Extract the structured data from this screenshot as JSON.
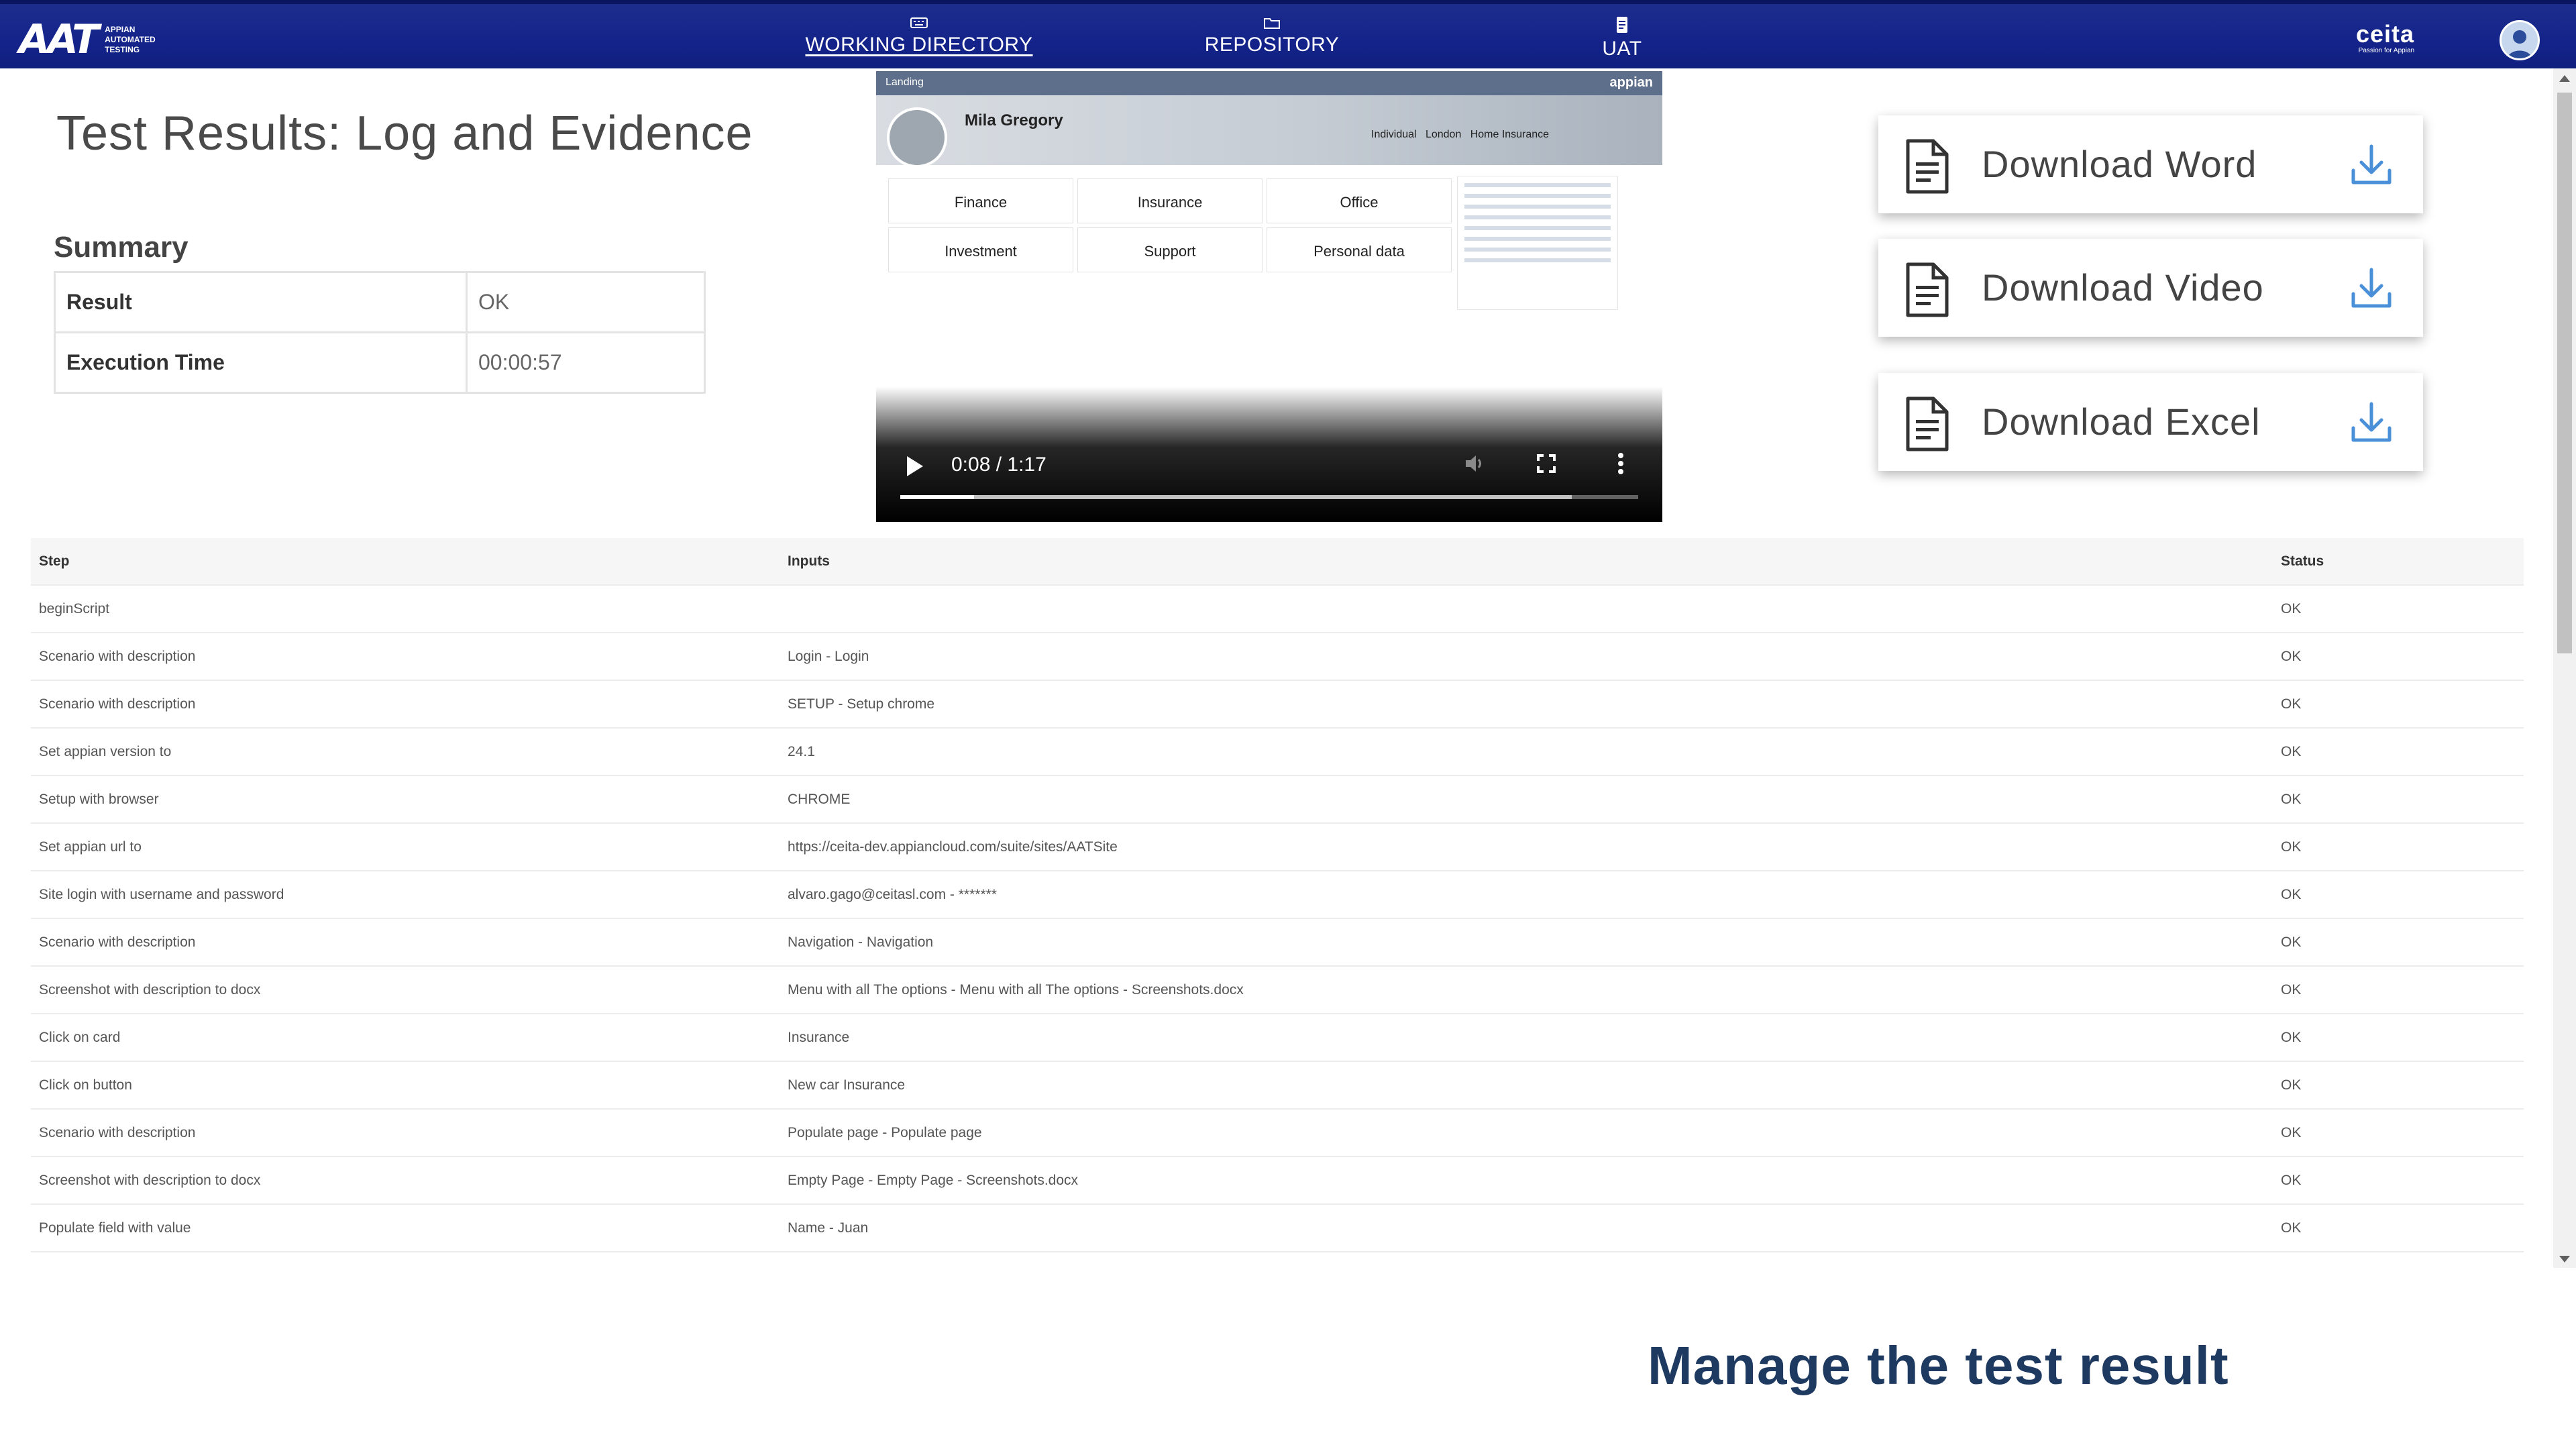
{
  "header": {
    "logo_mark": "AAT",
    "logo_sub": [
      "APPIAN",
      "AUTOMATED",
      "TESTING"
    ],
    "nav": [
      {
        "label": "WORKING DIRECTORY",
        "icon": "keyboard-icon",
        "active": true
      },
      {
        "label": "REPOSITORY",
        "icon": "folder-icon",
        "active": false
      },
      {
        "label": "UAT",
        "icon": "document-icon",
        "active": false
      }
    ],
    "brand": "ceita",
    "brand_tag": "Passion for Appian",
    "avatar_icon": "user-avatar-icon"
  },
  "page": {
    "title": "Test Results: Log and Evidence",
    "summary_title": "Summary",
    "summary": [
      {
        "key": "Result",
        "value": "OK"
      },
      {
        "key": "Execution Time",
        "value": "00:00:57"
      }
    ]
  },
  "video": {
    "frame": {
      "breadcrumb": "Landing",
      "app": "appian",
      "user_name": "Mila Gregory",
      "segment": "Individual",
      "office": "London",
      "contract": "Home Insurance",
      "cards": [
        "Finance",
        "Insurance",
        "Office",
        "Investment",
        "Support",
        "Personal data"
      ]
    },
    "time": "0:08 / 1:17",
    "progress_fraction": 0.1,
    "buffered_fraction": 0.91
  },
  "downloads": [
    {
      "label": "Download Word",
      "icon": "word-document-icon"
    },
    {
      "label": "Download Video",
      "icon": "video-document-icon"
    },
    {
      "label": "Download Excel",
      "icon": "excel-document-icon"
    }
  ],
  "steps": {
    "headers": {
      "step": "Step",
      "inputs": "Inputs",
      "status": "Status"
    },
    "rows": [
      {
        "step": "beginScript",
        "inputs": "",
        "status": "OK"
      },
      {
        "step": "Scenario with description",
        "inputs": "Login - Login",
        "status": "OK"
      },
      {
        "step": "Scenario with description",
        "inputs": "SETUP - Setup chrome",
        "status": "OK"
      },
      {
        "step": "Set appian version to",
        "inputs": "24.1",
        "status": "OK"
      },
      {
        "step": "Setup with browser",
        "inputs": "CHROME",
        "status": "OK"
      },
      {
        "step": "Set appian url to",
        "inputs": "https://ceita-dev.appiancloud.com/suite/sites/AATSite",
        "status": "OK"
      },
      {
        "step": "Site login with username and password",
        "inputs": "alvaro.gago@ceitasl.com - *******",
        "status": "OK"
      },
      {
        "step": "Scenario with description",
        "inputs": "Navigation - Navigation",
        "status": "OK"
      },
      {
        "step": "Screenshot with description to docx",
        "inputs": "Menu with all The options - Menu with all The options - Screenshots.docx",
        "status": "OK"
      },
      {
        "step": "Click on card",
        "inputs": "Insurance",
        "status": "OK"
      },
      {
        "step": "Click on button",
        "inputs": "New car Insurance",
        "status": "OK"
      },
      {
        "step": "Scenario with description",
        "inputs": "Populate page - Populate page",
        "status": "OK"
      },
      {
        "step": "Screenshot with description to docx",
        "inputs": "Empty Page - Empty Page - Screenshots.docx",
        "status": "OK"
      },
      {
        "step": "Populate field with value",
        "inputs": "Name - Juan",
        "status": "OK"
      }
    ]
  },
  "caption": "Manage the test result",
  "colors": {
    "nav_bg": "#14238a",
    "caption": "#1f3a60",
    "download_arrow": "#4a90d9"
  }
}
